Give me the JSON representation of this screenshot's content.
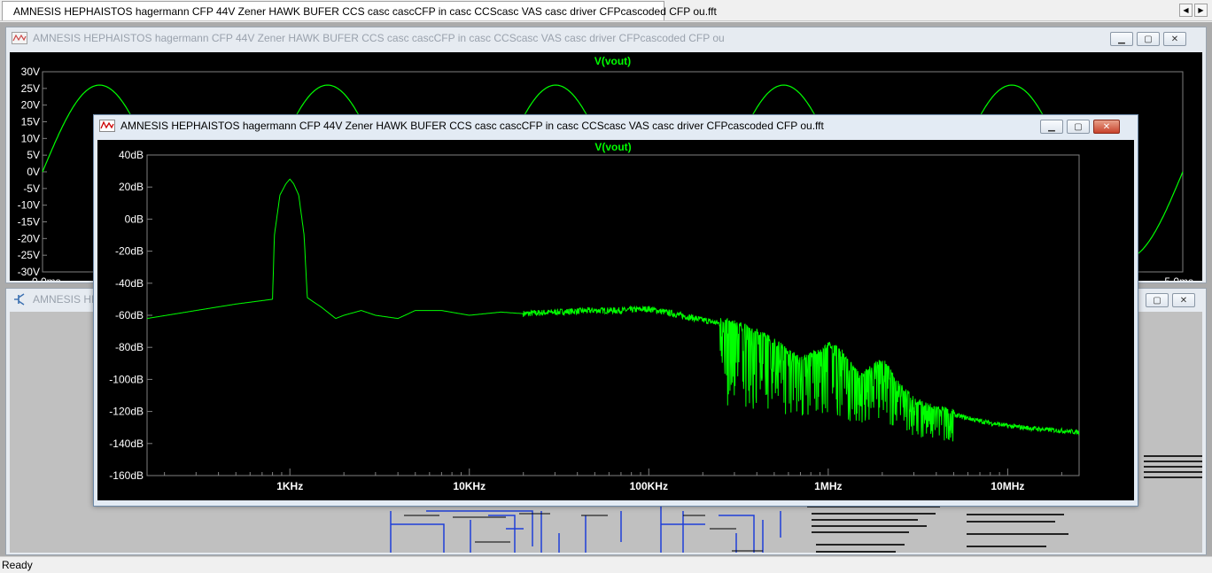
{
  "main_tab": {
    "title": "AMNESIS HEPHAISTOS hagermann  CFP 44V Zener HAWK BUFER CCS casc cascCFP in casc CCScasc VAS casc driver CFPcascoded CFP ou.fft",
    "nav_left": "◀",
    "nav_right": "▶"
  },
  "time_window": {
    "title": "AMNESIS HEPHAISTOS hagermann  CFP 44V Zener HAWK BUFER CCS casc cascCFP in casc CCScasc VAS casc driver CFPcascoded CFP ou",
    "buttons": {
      "minimize": "▁",
      "maximize": "▢",
      "close": "✕"
    }
  },
  "schematic_window": {
    "title": "AMNESIS HE",
    "buttons": {
      "maximize": "▢",
      "close": "✕"
    }
  },
  "fft_window": {
    "title": "AMNESIS HEPHAISTOS hagermann  CFP 44V Zener HAWK BUFER CCS casc cascCFP in casc CCScasc VAS casc driver CFPcascoded CFP ou.fft",
    "buttons": {
      "minimize": "▁",
      "maximize": "▢",
      "close": "✕"
    }
  },
  "status": {
    "text": "Ready"
  },
  "colors": {
    "trace": "#00ff00",
    "plot_bg": "#000000",
    "grid": "#808080",
    "axis_text": "#ffffff"
  },
  "chart_data": [
    {
      "type": "line",
      "title": "V(vout)",
      "xlabel": "",
      "ylabel": "",
      "x_tick_labels": [
        "0.0ms",
        "5.0ms"
      ],
      "xlim": [
        0,
        5.0
      ],
      "x_unit": "ms",
      "y_tick_labels": [
        "30V",
        "25V",
        "20V",
        "15V",
        "10V",
        "5V",
        "0V",
        "-5V",
        "-10V",
        "-15V",
        "-20V",
        "-25V",
        "-30V"
      ],
      "ylim": [
        -30,
        30
      ],
      "series": [
        {
          "name": "V(vout)",
          "amplitude": 26,
          "frequency_khz": 1.0,
          "x_ms": [
            0,
            0.25,
            0.5,
            0.75,
            1.0,
            1.25,
            1.5,
            1.75,
            2.0,
            2.25,
            2.5,
            2.75,
            3.0,
            3.25,
            3.5,
            3.75,
            4.0,
            4.25,
            4.5,
            4.75,
            5.0
          ],
          "y_v": [
            0,
            26,
            0,
            -26,
            0,
            26,
            0,
            -26,
            0,
            26,
            0,
            -26,
            0,
            26,
            0,
            -26,
            0,
            26,
            0,
            -26,
            0
          ]
        }
      ]
    },
    {
      "type": "line",
      "title": "V(vout)",
      "xlabel": "",
      "ylabel": "",
      "log_x": true,
      "x_tick_labels": [
        "1KHz",
        "10KHz",
        "100KHz",
        "1MHz",
        "10MHz"
      ],
      "x_ticks_hz": [
        1000,
        10000,
        100000,
        1000000,
        10000000
      ],
      "xlim_hz": [
        160,
        25000000
      ],
      "y_tick_labels": [
        "40dB",
        "20dB",
        "0dB",
        "-20dB",
        "-40dB",
        "-60dB",
        "-80dB",
        "-100dB",
        "-120dB",
        "-140dB",
        "-160dB"
      ],
      "ylim": [
        -160,
        40
      ],
      "series": [
        {
          "name": "V(vout)",
          "freq_hz": [
            160,
            300,
            500,
            800,
            820,
            880,
            950,
            1000,
            1050,
            1120,
            1200,
            1250,
            1500,
            1800,
            2000,
            2500,
            3000,
            4000,
            5000,
            7000,
            10000,
            15000,
            20000,
            30000,
            50000,
            70000,
            100000,
            150000,
            200000,
            300000,
            400000,
            500000,
            700000,
            900000,
            1000000,
            1200000,
            1500000,
            2000000,
            2500000,
            3000000,
            4000000,
            5000000,
            7000000,
            10000000,
            15000000,
            20000000,
            25000000
          ],
          "db": [
            -62,
            -57,
            -53,
            -50,
            -10,
            15,
            22,
            25,
            22,
            15,
            -10,
            -49,
            -55,
            -62,
            -60,
            -57,
            -60,
            -62,
            -57,
            -57,
            -60,
            -58,
            -59,
            -58,
            -57,
            -57,
            -56,
            -60,
            -63,
            -67,
            -72,
            -78,
            -90,
            -84,
            -80,
            -85,
            -100,
            -90,
            -105,
            -115,
            -120,
            -122,
            -126,
            -129,
            -131,
            -132,
            -133
          ],
          "noise_band_hz": [
            250000,
            5000000
          ],
          "noise_floor_db": -150
        }
      ]
    }
  ]
}
